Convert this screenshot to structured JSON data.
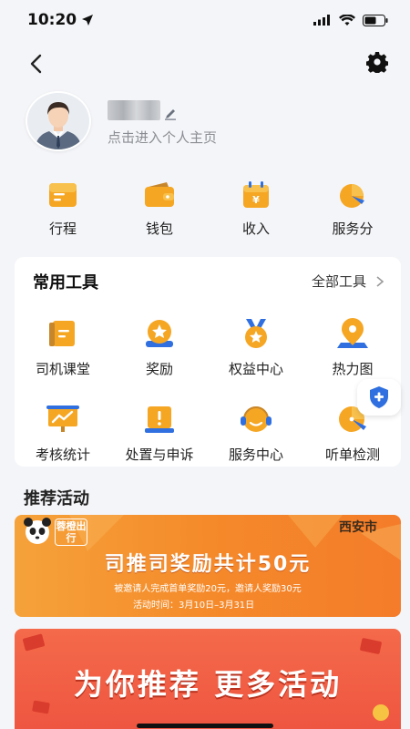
{
  "status_bar": {
    "time": "10:20"
  },
  "profile": {
    "subtitle": "点击进入个人主页"
  },
  "quick_links": [
    {
      "label": "行程",
      "icon": "itinerary-icon"
    },
    {
      "label": "钱包",
      "icon": "wallet-icon"
    },
    {
      "label": "收入",
      "icon": "income-icon"
    },
    {
      "label": "服务分",
      "icon": "service-score-icon"
    }
  ],
  "tools": {
    "title": "常用工具",
    "all_label": "全部工具",
    "items": [
      {
        "label": "司机课堂",
        "icon": "driver-class-icon"
      },
      {
        "label": "奖励",
        "icon": "reward-icon"
      },
      {
        "label": "权益中心",
        "icon": "benefits-icon"
      },
      {
        "label": "热力图",
        "icon": "heatmap-icon"
      },
      {
        "label": "考核统计",
        "icon": "assessment-icon"
      },
      {
        "label": "处置与申诉",
        "icon": "appeal-icon"
      },
      {
        "label": "服务中心",
        "icon": "service-center-icon"
      },
      {
        "label": "听单检测",
        "icon": "order-check-icon"
      }
    ]
  },
  "activities": {
    "title": "推荐活动",
    "banner1": {
      "brand": "蓉橙出行",
      "city": "西安市",
      "headline": "司推司奖励共计50元",
      "description": "被邀请人完成首单奖励20元，邀请人奖励30元",
      "period": "活动时间：3月10日–3月31日"
    },
    "banner2": {
      "headline": "为你推荐  更多活动"
    }
  },
  "colors": {
    "accent_orange": "#f5a623",
    "accent_blue": "#2f6fe0",
    "background": "#f4f5f8"
  }
}
